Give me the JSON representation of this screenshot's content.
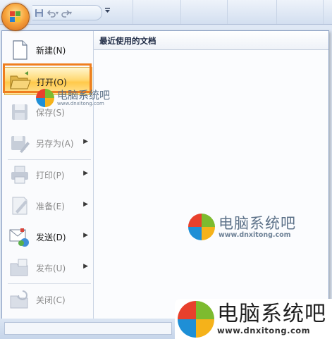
{
  "quick_access": {
    "save_icon": "save-icon",
    "undo_icon": "undo-icon",
    "redo_icon": "redo-icon",
    "customize_icon": "customize-toolbar-icon"
  },
  "office_button": {
    "icon": "office-logo-icon"
  },
  "menu": {
    "items": [
      {
        "label": "新建(N)",
        "icon": "new-document-icon",
        "enabled": true,
        "submenu": false
      },
      {
        "label": "打开(O)",
        "icon": "open-folder-icon",
        "enabled": true,
        "submenu": false,
        "active": true
      },
      {
        "label": "保存(S)",
        "icon": "save-disk-icon",
        "enabled": false,
        "submenu": false
      },
      {
        "label": "另存为(A)",
        "icon": "save-as-icon",
        "enabled": false,
        "submenu": true
      },
      {
        "label": "打印(P)",
        "icon": "printer-icon",
        "enabled": false,
        "submenu": true
      },
      {
        "label": "准备(E)",
        "icon": "prepare-icon",
        "enabled": false,
        "submenu": true
      },
      {
        "label": "发送(D)",
        "icon": "send-icon",
        "enabled": true,
        "submenu": true
      },
      {
        "label": "发布(U)",
        "icon": "publish-icon",
        "enabled": false,
        "submenu": true
      },
      {
        "label": "关闭(C)",
        "icon": "close-folder-icon",
        "enabled": false,
        "submenu": false
      }
    ],
    "recent_title": "最近使用的文档"
  },
  "watermark": {
    "title": "电脑系统吧",
    "url": "www.dnxitong.com",
    "colors": {
      "red": "#e8402c",
      "green": "#7dbb2f",
      "blue": "#1e8fd6",
      "yellow": "#f5b21a"
    }
  },
  "colors": {
    "highlight_frame": "#ef7e1f",
    "hover_fill": "#ffd974",
    "menu_border": "#8da2c4"
  }
}
